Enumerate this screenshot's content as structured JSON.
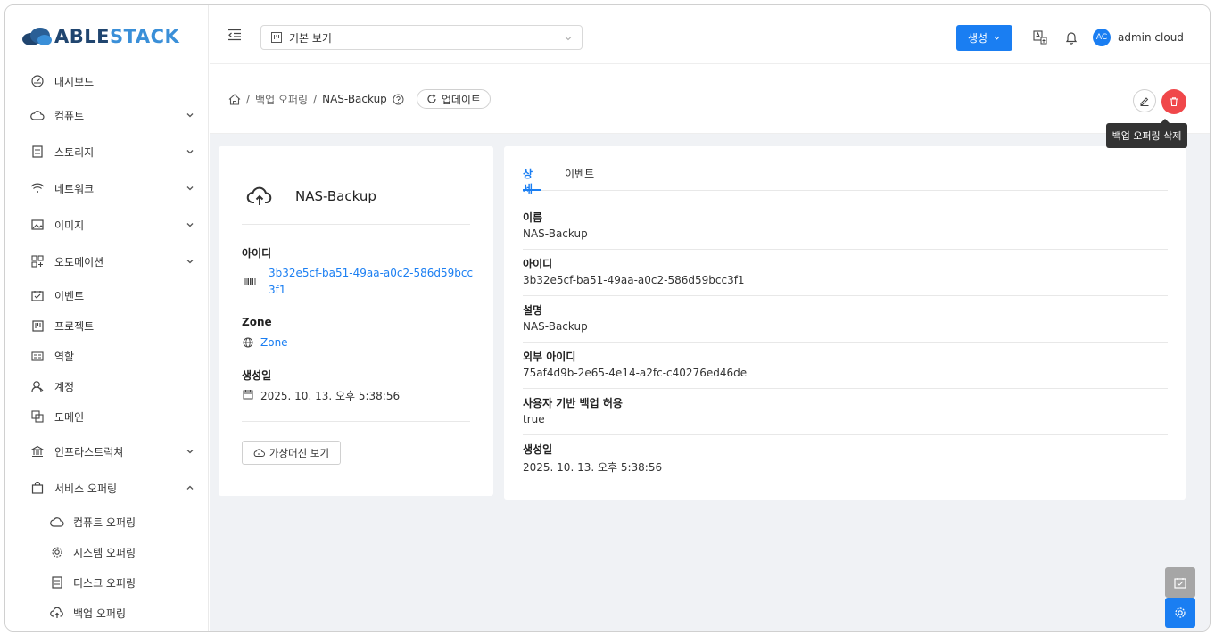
{
  "logo": {
    "part1": "ABLE",
    "part2": "STACK"
  },
  "sidebar": {
    "items": [
      {
        "label": "대시보드"
      },
      {
        "label": "컴퓨트"
      },
      {
        "label": "스토리지"
      },
      {
        "label": "네트워크"
      },
      {
        "label": "이미지"
      },
      {
        "label": "오토메이션"
      },
      {
        "label": "이벤트"
      },
      {
        "label": "프로젝트"
      },
      {
        "label": "역할"
      },
      {
        "label": "계정"
      },
      {
        "label": "도메인"
      },
      {
        "label": "인프라스트럭쳐"
      },
      {
        "label": "서비스 오퍼링"
      }
    ],
    "subitems": [
      {
        "label": "컴퓨트 오퍼링"
      },
      {
        "label": "시스템 오퍼링"
      },
      {
        "label": "디스크 오퍼링"
      },
      {
        "label": "백업 오퍼링"
      }
    ]
  },
  "header": {
    "view_select": "기본 보기",
    "create_label": "생성",
    "user_initials": "AC",
    "user_name": "admin cloud"
  },
  "breadcrumb": {
    "parent": "백업 오퍼링",
    "current": "NAS-Backup",
    "update_label": "업데이트",
    "sep": "/"
  },
  "tooltip": "백업 오퍼링 삭제",
  "left_card": {
    "title": "NAS-Backup",
    "id_label": "아이디",
    "id_line1": "3b32e5cf-ba51-49aa-a0c2-586d59bcc",
    "id_line2": "3f1",
    "zone_label": "Zone",
    "zone_value": "Zone",
    "created_label": "생성일",
    "created_value": "2025. 10. 13. 오후 5:38:56",
    "vm_button": "가상머신 보기"
  },
  "right_card": {
    "tabs": [
      "상세",
      "이벤트"
    ],
    "rows": [
      {
        "label": "이름",
        "value": "NAS-Backup"
      },
      {
        "label": "아이디",
        "value": "3b32e5cf-ba51-49aa-a0c2-586d59bcc3f1"
      },
      {
        "label": "설명",
        "value": "NAS-Backup"
      },
      {
        "label": "외부 아이디",
        "value": "75af4d9b-2e65-4e14-a2fc-c40276ed46de"
      },
      {
        "label": "사용자 기반 백업 허용",
        "value": "true"
      },
      {
        "label": "생성일",
        "value": "2025. 10. 13. 오후 5:38:56"
      }
    ]
  },
  "colors": {
    "primary": "#1a7ef2",
    "danger": "#f0474a",
    "logo_dark": "#20456f",
    "logo_light": "#3a8fd8"
  }
}
